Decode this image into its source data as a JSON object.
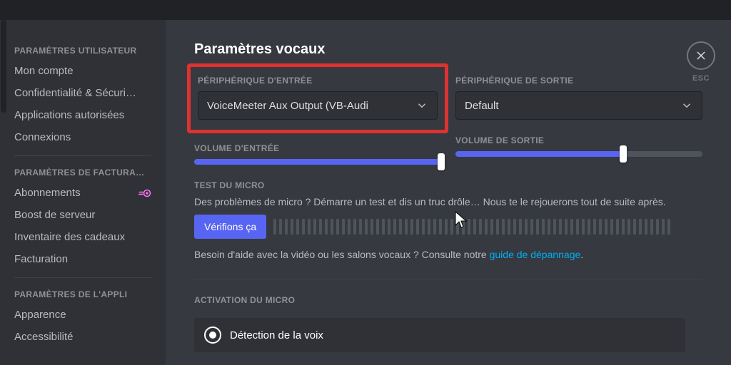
{
  "sidebar": {
    "groups": [
      {
        "label": "PARAMÈTRES UTILISATEUR",
        "items": [
          {
            "label": "Mon compte"
          },
          {
            "label": "Confidentialité & Sécuri…"
          },
          {
            "label": "Applications autorisées"
          },
          {
            "label": "Connexions"
          }
        ]
      },
      {
        "label": "PARAMÈTRES DE FACTURA…",
        "items": [
          {
            "label": "Abonnements",
            "nitro": true
          },
          {
            "label": "Boost de serveur"
          },
          {
            "label": "Inventaire des cadeaux"
          },
          {
            "label": "Facturation"
          }
        ]
      },
      {
        "label": "PARAMÈTRES DE L'APPLI",
        "items": [
          {
            "label": "Apparence"
          },
          {
            "label": "Accessibilité"
          }
        ]
      }
    ]
  },
  "page": {
    "title": "Paramètres vocaux",
    "esc_label": "ESC"
  },
  "input_device": {
    "label": "PÉRIPHÉRIQUE D'ENTRÉE",
    "value": "VoiceMeeter Aux Output (VB-Audi",
    "volume_label": "VOLUME D'ENTRÉE",
    "volume_percent": 100
  },
  "output_device": {
    "label": "PÉRIPHÉRIQUE DE SORTIE",
    "value": "Default",
    "volume_label": "VOLUME DE SORTIE",
    "volume_percent": 68
  },
  "mic_test": {
    "label": "TEST DU MICRO",
    "desc": "Des problèmes de micro ? Démarre un test et dis un truc drôle… Nous te le rejouerons tout de suite après.",
    "button": "Vérifions ça",
    "help_prefix": "Besoin d'aide avec la vidéo ou les salons vocaux ? Consulte notre ",
    "help_link": "guide de dépannage",
    "help_suffix": "."
  },
  "activation": {
    "label": "ACTIVATION DU MICRO",
    "option": "Détection de la voix"
  }
}
